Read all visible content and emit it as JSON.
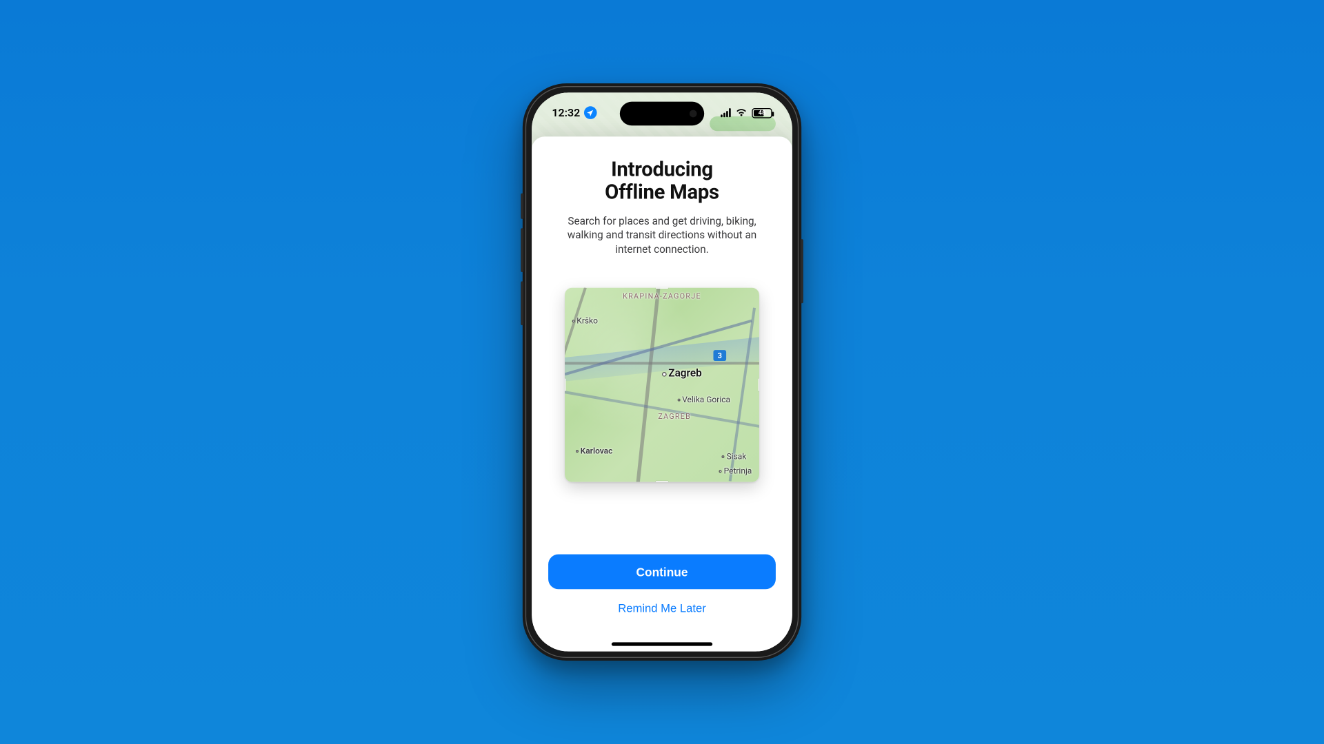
{
  "status_bar": {
    "time": "12:32",
    "battery_level": "48"
  },
  "sheet": {
    "title_line1": "Introducing",
    "title_line2": "Offline Maps",
    "subtitle": "Search for places and get driving, biking, walking and transit directions without an internet connection."
  },
  "map_preview": {
    "region_label_1": "Krapina-Zagorje",
    "region_label_2": "Zagreb",
    "city_main": "Zagreb",
    "town_1": "Krško",
    "town_2": "Velika Gorica",
    "town_3": "Karlovac",
    "town_4": "Sisak",
    "town_5": "Petrinja",
    "route_shield": "3"
  },
  "actions": {
    "primary": "Continue",
    "secondary": "Remind Me Later"
  }
}
